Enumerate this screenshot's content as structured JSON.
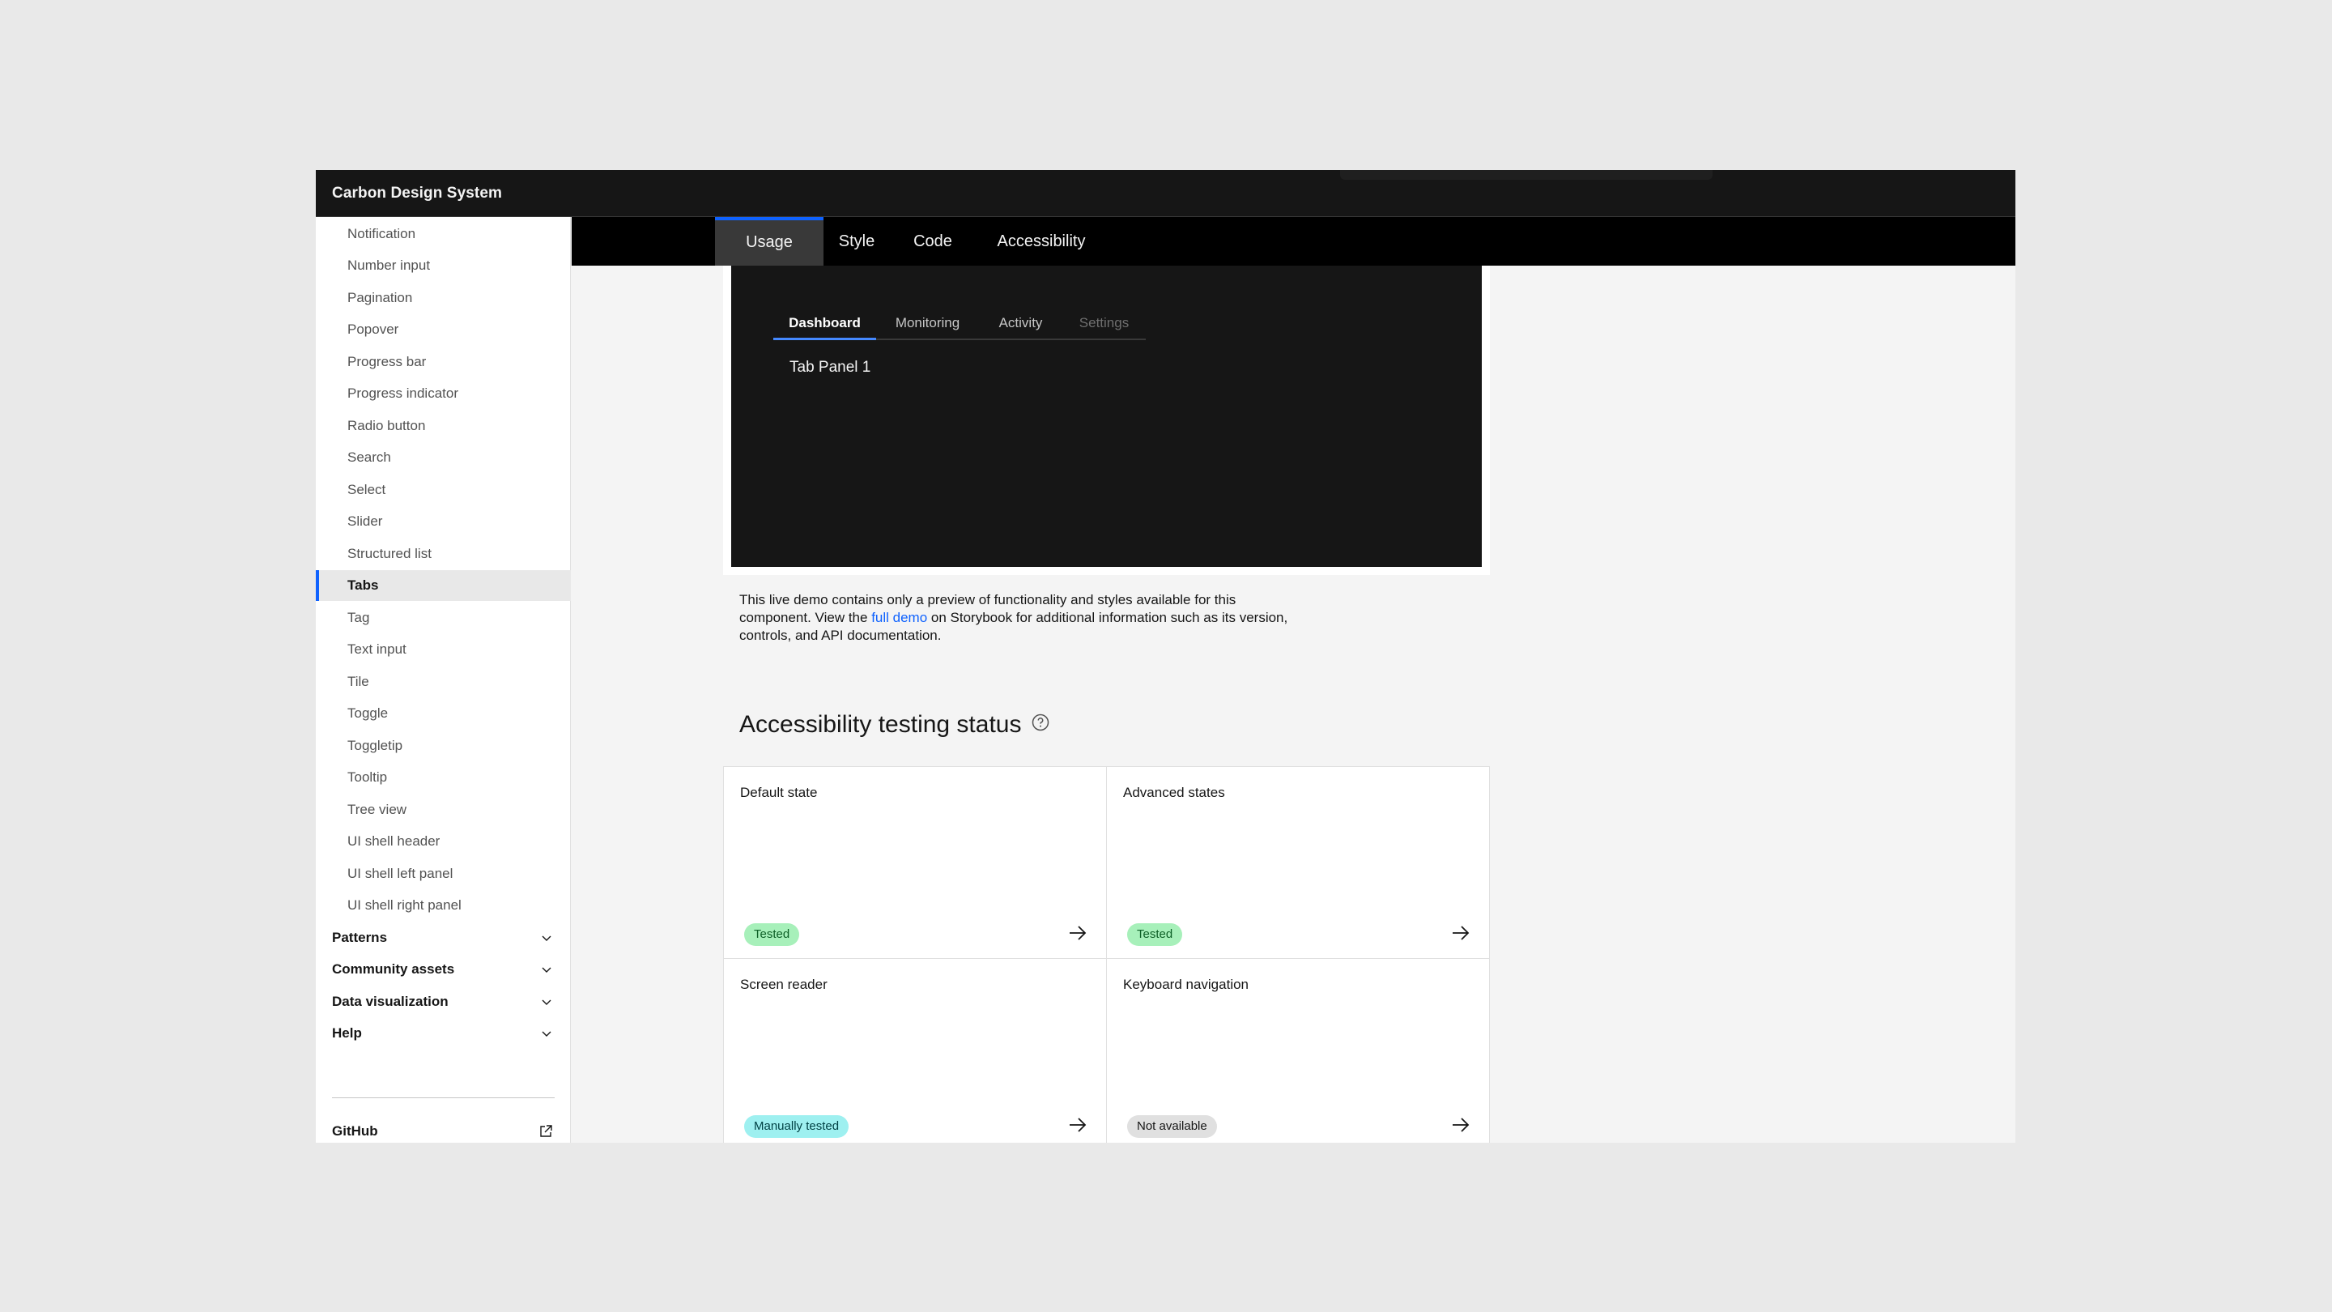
{
  "app": {
    "title": "Carbon Design System"
  },
  "sidebar": {
    "items": [
      {
        "label": "Notification"
      },
      {
        "label": "Number input"
      },
      {
        "label": "Pagination"
      },
      {
        "label": "Popover"
      },
      {
        "label": "Progress bar"
      },
      {
        "label": "Progress indicator"
      },
      {
        "label": "Radio button"
      },
      {
        "label": "Search"
      },
      {
        "label": "Select"
      },
      {
        "label": "Slider"
      },
      {
        "label": "Structured list"
      },
      {
        "label": "Tabs",
        "active": true
      },
      {
        "label": "Tag"
      },
      {
        "label": "Text input"
      },
      {
        "label": "Tile"
      },
      {
        "label": "Toggle"
      },
      {
        "label": "Toggletip"
      },
      {
        "label": "Tooltip"
      },
      {
        "label": "Tree view"
      },
      {
        "label": "UI shell header"
      },
      {
        "label": "UI shell left panel"
      },
      {
        "label": "UI shell right panel"
      }
    ],
    "sections": [
      {
        "label": "Patterns"
      },
      {
        "label": "Community assets"
      },
      {
        "label": "Data visualization"
      },
      {
        "label": "Help"
      }
    ],
    "github": "GitHub"
  },
  "page_tabs": [
    "Usage",
    "Style",
    "Code",
    "Accessibility"
  ],
  "page_tab_active": "Usage",
  "demo": {
    "tabs": [
      "Dashboard",
      "Monitoring",
      "Activity",
      "Settings"
    ],
    "active_tab": "Dashboard",
    "disabled_tab": "Settings",
    "panel_text": "Tab Panel 1"
  },
  "note": {
    "before_link": "This live demo contains only a preview of functionality and styles available for this component. View the ",
    "link_text": "full demo",
    "after_link": " on Storybook for additional information such as its version, controls, and API documentation."
  },
  "accessibility": {
    "heading": "Accessibility testing status",
    "cards": [
      {
        "title": "Default state",
        "status": "Tested",
        "status_color": "#a7f0ba"
      },
      {
        "title": "Advanced states",
        "status": "Tested",
        "status_color": "#a7f0ba"
      },
      {
        "title": "Screen reader",
        "status": "Manually tested",
        "status_color": "#9ef0f0"
      },
      {
        "title": "Keyboard navigation",
        "status": "Not available",
        "status_color": "#e0e0e0"
      }
    ]
  },
  "colors": {
    "accent": "#0f62fe",
    "header_bg": "#161616",
    "tabbar_bg": "#000000"
  }
}
